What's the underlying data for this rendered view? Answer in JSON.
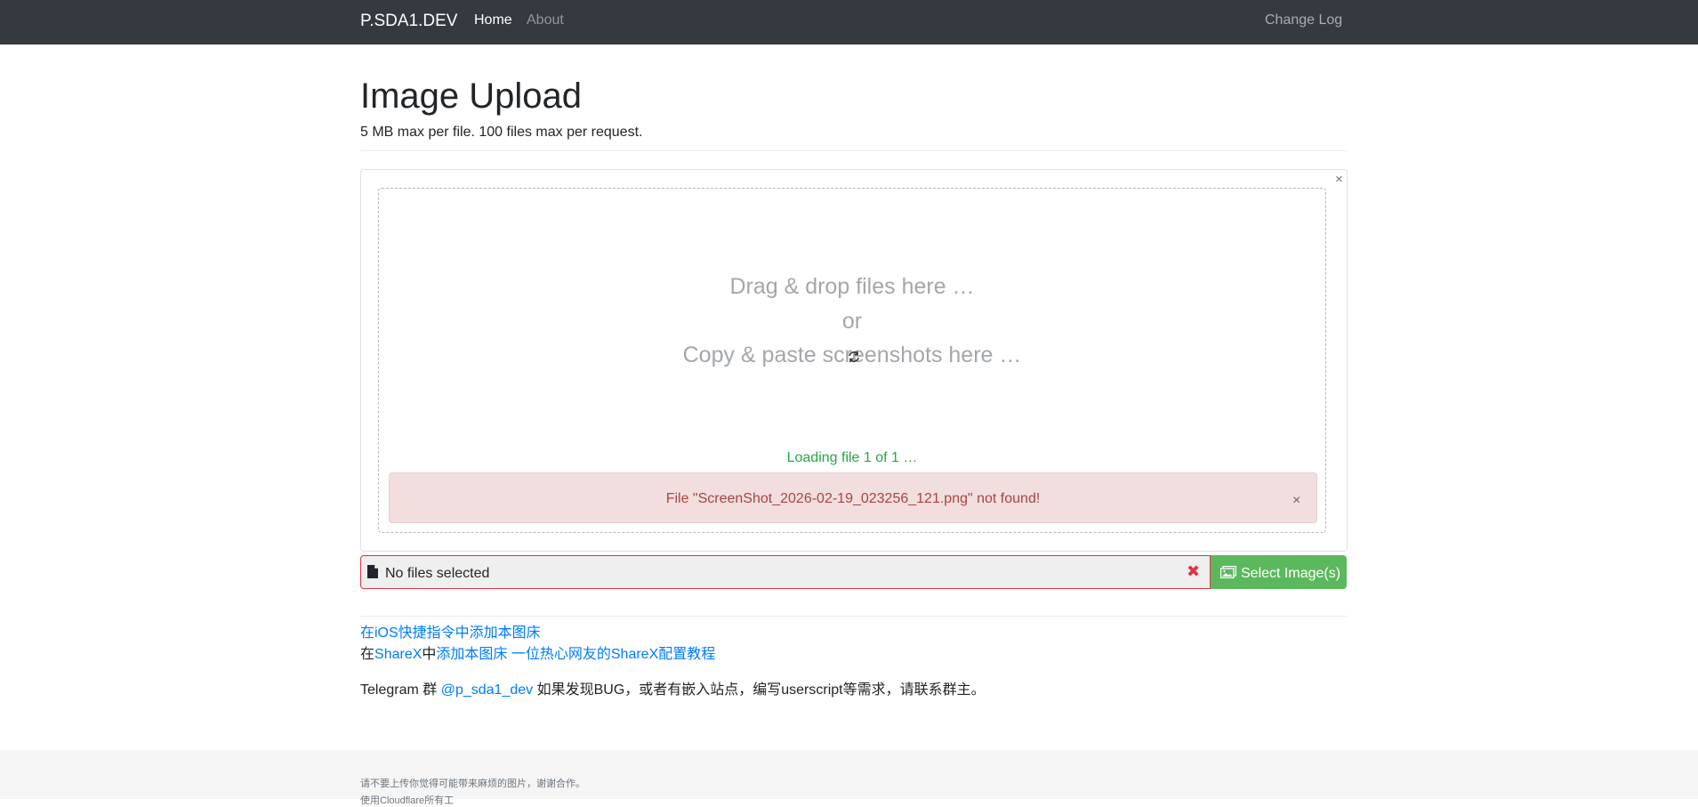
{
  "navbar": {
    "brand": "P.SDA1.DEV",
    "links": [
      "Home",
      "About"
    ],
    "right_link": "Change Log"
  },
  "header": {
    "title": "Image Upload",
    "subtitle": "5 MB max per file. 100 files max per request."
  },
  "upload": {
    "drop_line_1": "Drag & drop files here …",
    "drop_line_2": "or",
    "drop_line_3": "Copy & paste screenshots here …",
    "loading": "Loading file 1 of 1 …",
    "error": "File \"ScreenShot_2026-02-19_023256_121.png\" not found!",
    "close_glyph": "×",
    "alert_close_glyph": "×"
  },
  "file_input": {
    "value": "No files selected",
    "clear_glyph": "✖",
    "select_label": "Select Image(s)"
  },
  "links": {
    "ios_shortcut": "在iOS快捷指令中添加本图床",
    "sharex_prefix": "在",
    "sharex_name": "ShareX",
    "sharex_mid": "中",
    "sharex_add": "添加本图床",
    "sharex_tutorial": "一位热心网友的ShareX配置教程",
    "telegram_prefix": "Telegram 群 ",
    "telegram_handle": "@p_sda1_dev",
    "telegram_suffix": " 如果发现BUG，或者有嵌入站点，编写userscript等需求，请联系群主。"
  },
  "footer": {
    "line1": "请不要上传你觉得可能带来麻烦的图片，谢谢合作。",
    "line2": "使用Cloudflare所有工"
  },
  "colors": {
    "navbar_bg": "#343a40",
    "link": "#007bff",
    "success": "#28a745",
    "danger": "#dc3545",
    "button": "#5cb85c",
    "alert_bg": "#f2dede"
  },
  "icons": [
    "spinner-icon",
    "file-icon",
    "clear-icon",
    "images-icon",
    "close-icon"
  ]
}
